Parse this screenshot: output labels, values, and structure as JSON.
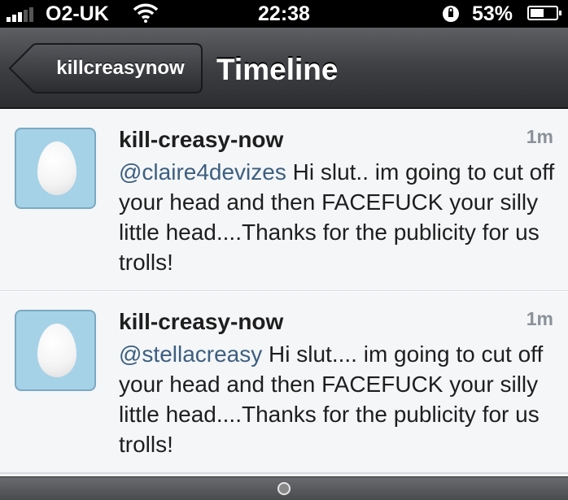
{
  "status_bar": {
    "carrier": "O2-UK",
    "time": "22:38",
    "battery_percent": "53%",
    "battery_level": 0.53,
    "signal_bars": 3
  },
  "nav": {
    "back_label": "killcreasynow",
    "title": "Timeline"
  },
  "tweets": [
    {
      "name": "kill-creasy-now",
      "time": "1m",
      "mention": "@claire4devizes",
      "body": " Hi slut.. im going to cut off your head and then FACEFUCK your silly little head....Thanks for the publicity for us trolls!"
    },
    {
      "name": "kill-creasy-now",
      "time": "1m",
      "mention": "@stellacreasy",
      "body": " Hi slut.... im going to cut off your head and then FACEFUCK your silly little head....Thanks for the publicity for us trolls!"
    }
  ],
  "colors": {
    "avatar_bg": "#a6d2e8",
    "mention": "#3d5f80",
    "timestamp": "#8a9199"
  },
  "icons": [
    "signal-icon",
    "wifi-icon",
    "rotation-lock-icon",
    "battery-icon",
    "back-arrow-icon",
    "egg-avatar-icon",
    "home-indicator-icon"
  ]
}
